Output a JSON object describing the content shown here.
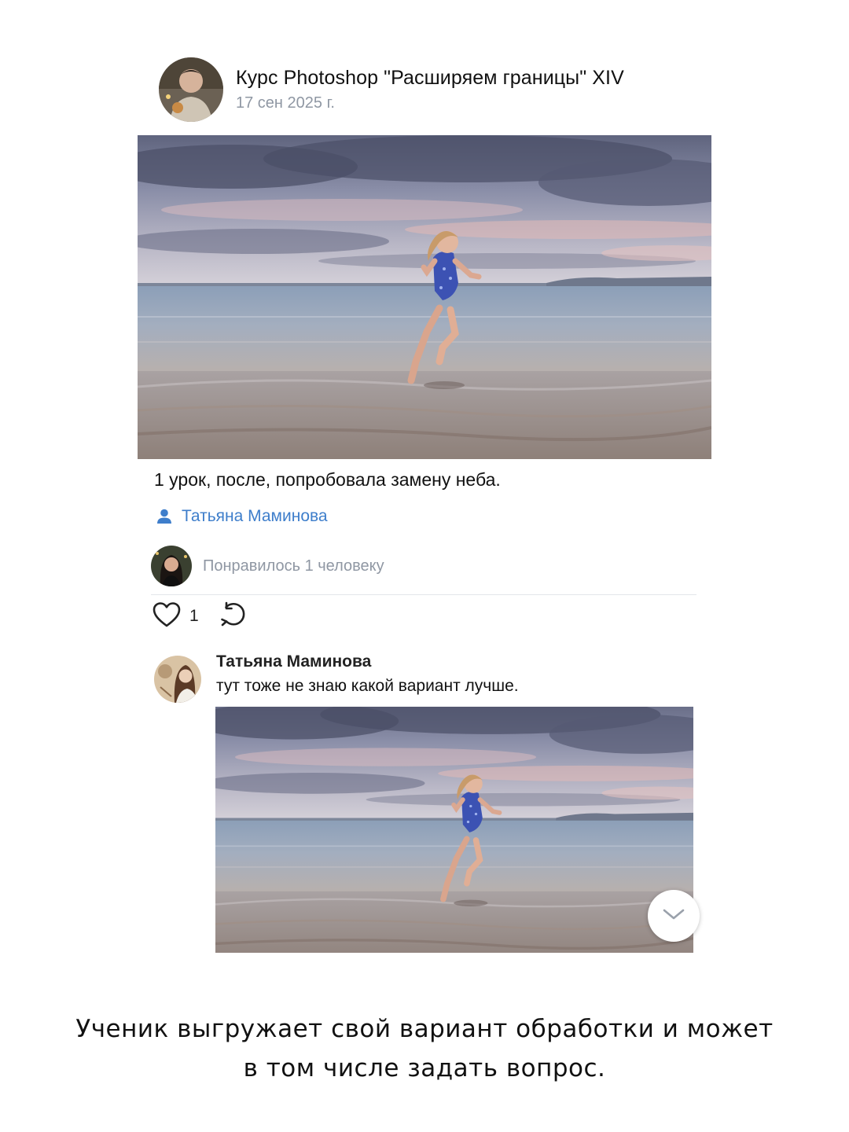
{
  "post": {
    "title": "Курс Photoshop \"Расширяем границы\" XIV",
    "date": "17 сен 2025 г.",
    "caption": "1 урок, после, попробовала замену неба.",
    "author": "Татьяна Маминова",
    "liked_by": "Понравилось 1 человеку",
    "like_count": "1"
  },
  "comment": {
    "author": "Татьяна Маминова",
    "text": "тут тоже не знаю какой вариант лучше."
  },
  "footer": {
    "line1": "Ученик выгружает свой вариант обработки и может",
    "line2": "в том числе задать вопрос."
  },
  "colors": {
    "link": "#3e7ecb",
    "muted": "#8f97a3",
    "divider": "#e3e6ea"
  },
  "icons": {
    "author": "person-icon",
    "like": "heart-icon",
    "share": "share-icon",
    "scroll": "chevron-down-icon"
  }
}
